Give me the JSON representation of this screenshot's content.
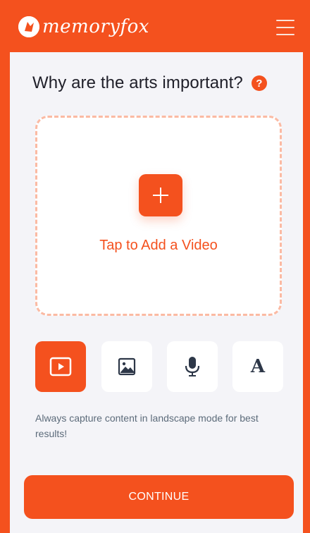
{
  "header": {
    "brand": "memoryfox",
    "menu_icon": "hamburger-menu-icon"
  },
  "question": {
    "title": "Why are the arts important?",
    "help_icon": "help-icon",
    "help_glyph": "?"
  },
  "upload": {
    "add_icon": "plus-icon",
    "label": "Tap to Add a Video"
  },
  "media_types": [
    {
      "name": "video",
      "icon": "video-play-icon",
      "selected": true
    },
    {
      "name": "image",
      "icon": "image-icon",
      "selected": false
    },
    {
      "name": "audio",
      "icon": "microphone-icon",
      "selected": false
    },
    {
      "name": "text",
      "icon": "text-icon",
      "selected": false,
      "glyph": "A"
    }
  ],
  "hint": "Always capture content in landscape mode for best results!",
  "continue_label": "CONTINUE",
  "colors": {
    "accent": "#f4511e",
    "background": "#f4f4f8",
    "dashed_border": "#fbbaa3",
    "title_text": "#1f1f29",
    "hint_text": "#5c6b7a"
  }
}
